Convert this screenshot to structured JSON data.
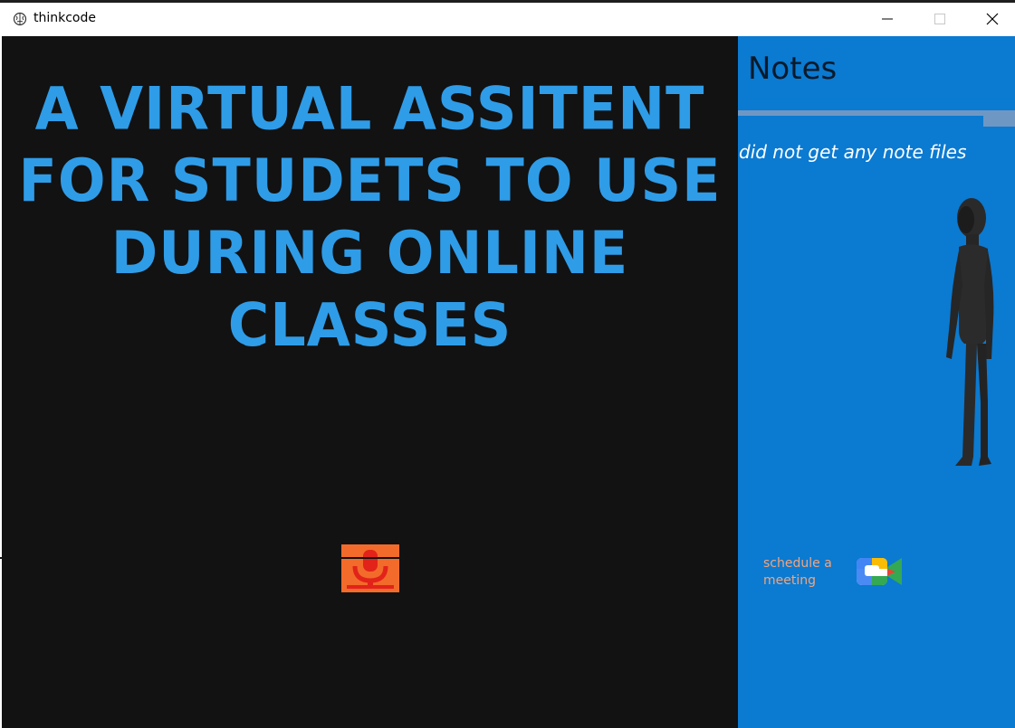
{
  "window": {
    "title": "thinkcode",
    "controls": {
      "minimize_icon": "minimize-icon",
      "maximize_icon": "maximize-icon",
      "close_icon": "close-icon"
    }
  },
  "main": {
    "headline_lines": [
      "A VIRTUAL ASSITENT",
      "FOR STUDETS TO USE",
      "DURING ONLINE CLASSES"
    ],
    "mic_icon": "microphone-icon"
  },
  "notes_panel": {
    "title": "Notes",
    "message": "did not get any note files",
    "schedule_label": "schedule a meeting",
    "meet_icon": "google-meet-icon"
  },
  "colors": {
    "headline": "#2f9ce8",
    "main_background": "#121212",
    "panel_background": "#0b7ad1",
    "mic_background": "#f26b2a",
    "mic_glyph": "#e2231a",
    "schedule_text": "#f2a57c"
  }
}
